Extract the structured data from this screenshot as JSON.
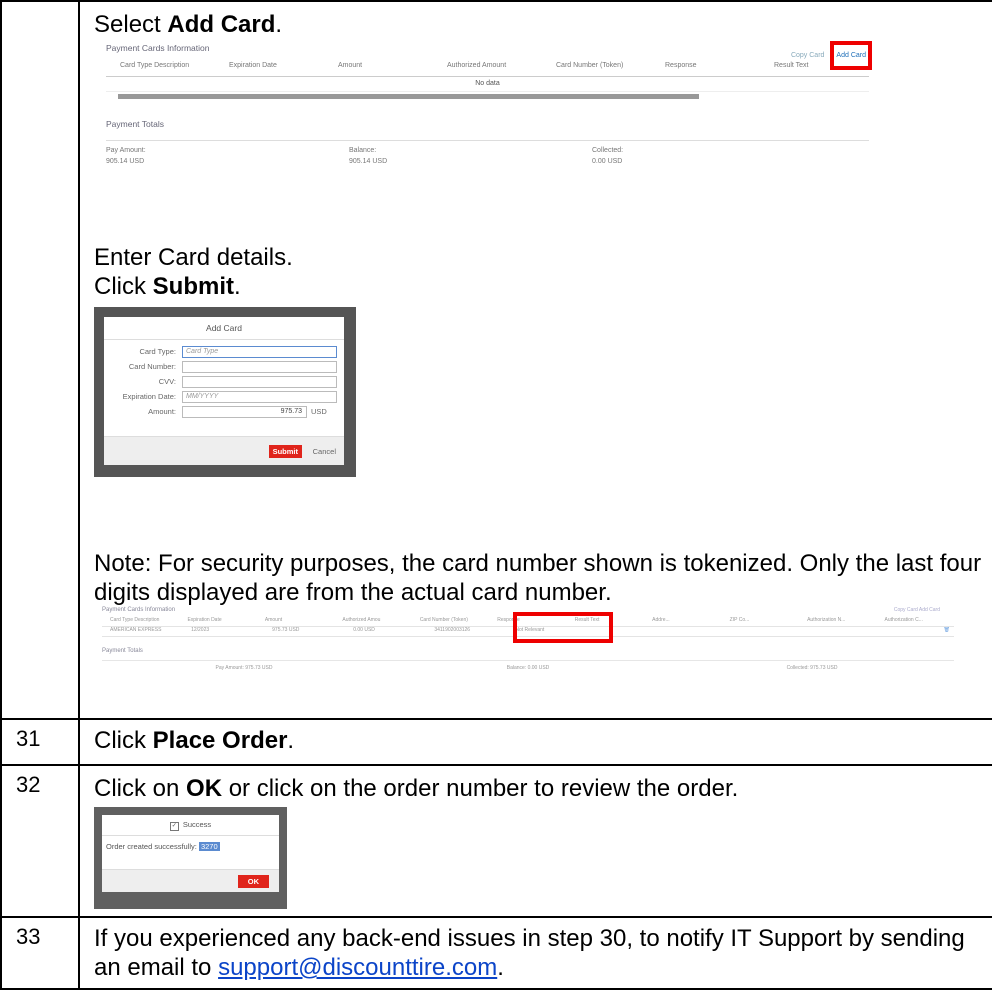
{
  "step30": {
    "select_prefix": "Select ",
    "select_bold": "Add Card",
    "select_suffix": ".",
    "shot1": {
      "title": "Payment Cards Information",
      "copy_card": "Copy Card",
      "add_card": "Add Card",
      "columns": [
        "Card Type Description",
        "Expiration Date",
        "Amount",
        "Authorized Amount",
        "Card Number (Token)",
        "Response",
        "Result Text"
      ],
      "no_data": "No data",
      "totals_title": "Payment Totals",
      "pay_amount_label": "Pay Amount:",
      "pay_amount": "905.14 USD",
      "balance_label": "Balance:",
      "balance": "905.14 USD",
      "collected_label": "Collected:",
      "collected": "0.00 USD"
    },
    "enter_details": "Enter Card details.",
    "click_prefix": "Click ",
    "click_bold": "Submit",
    "click_suffix": ".",
    "dialog": {
      "title": "Add Card",
      "card_type_label": "Card Type:",
      "card_type_placeholder": "Card Type",
      "card_number_label": "Card Number:",
      "cvv_label": "CVV:",
      "exp_label": "Expiration Date:",
      "exp_placeholder": "MM/YYYY",
      "amount_label": "Amount:",
      "amount": "975.73",
      "currency": "USD",
      "submit": "Submit",
      "cancel": "Cancel"
    },
    "note": "Note: For security purposes, the card number shown is tokenized. Only the last four digits displayed are from the actual card number.",
    "shot3": {
      "title": "Payment Cards Information",
      "links": "Copy Card   Add Card",
      "columns": [
        "Card Type Description",
        "Expiration Date",
        "Amount",
        "Authorized Amou",
        "Card Number (Token)",
        "Response",
        "Result Text",
        "Addre...",
        "ZIP Co...",
        "Authorization N...",
        "Authorization C..."
      ],
      "row": [
        "AMERICAN EXPRESS",
        "12/2023",
        "975.73 USD",
        "0.00 USD",
        "3411902003126",
        "Not Relevant",
        "",
        "",
        "",
        "",
        ""
      ],
      "totals_title": "Payment Totals",
      "pay_amount": "Pay Amount: 975.73 USD",
      "balance": "Balance: 0.00 USD",
      "collected": "Collected: 975.73 USD"
    }
  },
  "step31": {
    "number": "31",
    "prefix": "Click ",
    "bold": "Place Order",
    "suffix": "."
  },
  "step32": {
    "number": "32",
    "prefix": "Click on ",
    "bold": "OK",
    "suffix": " or click on the order number to review the order.",
    "dialog": {
      "title": "Success",
      "message": "Order created successfully:",
      "order_no": "3270",
      "ok": "OK"
    }
  },
  "step33": {
    "number": "33",
    "text": "If you experienced any back-end issues in step 30, to notify IT Support by sending an email to ",
    "email": "support@discounttire.com",
    "suffix": "."
  }
}
